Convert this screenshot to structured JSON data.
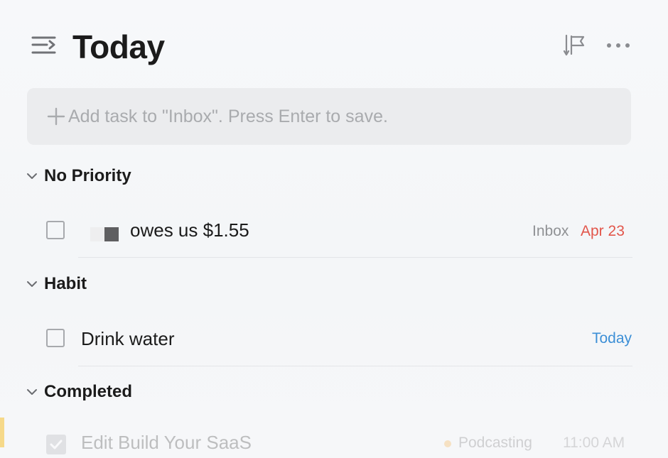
{
  "header": {
    "title": "Today",
    "menu_icon": "sidebar-toggle-icon",
    "sort_icon": "sort-by-priority-icon",
    "more_icon": "more-horizontal-icon"
  },
  "add_task": {
    "placeholder": "Add task to \"Inbox\". Press Enter to save.",
    "icon": "plus-icon"
  },
  "sections": [
    {
      "name": "No Priority",
      "tasks": [
        {
          "title": "owes us $1.55",
          "list": "Inbox",
          "date": "Apr 23",
          "date_color": "#e2564b"
        }
      ]
    },
    {
      "name": "Habit",
      "tasks": [
        {
          "title": "Drink water",
          "list": "",
          "date": "Today",
          "date_color": "#3d8fd6"
        }
      ]
    },
    {
      "name": "Completed",
      "tasks": [
        {
          "title": "Edit Build Your SaaS",
          "tag": "Podcasting",
          "time": "11:00 AM",
          "tag_color": "#f5b75e"
        }
      ]
    }
  ],
  "colors": {
    "accent_yellow": "#f6d98a",
    "overdue_red": "#e2564b",
    "today_blue": "#3d8fd6"
  }
}
